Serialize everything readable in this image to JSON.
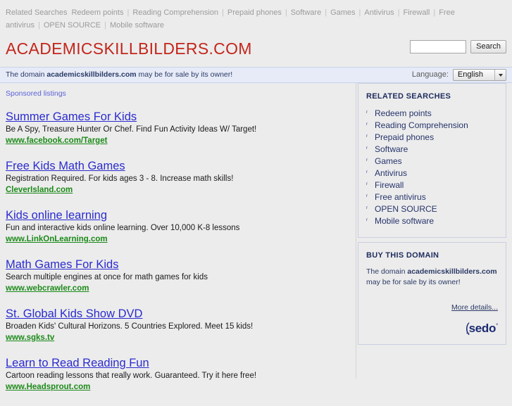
{
  "topnav": {
    "label": "Related Searches",
    "separator": "|",
    "items": [
      "Redeem points",
      "Reading Comprehension",
      "Prepaid phones",
      "Software",
      "Games",
      "Antivirus",
      "Firewall",
      "Free antivirus",
      "OPEN SOURCE",
      "Mobile software"
    ]
  },
  "header": {
    "logo": "ACADEMICSKILLBILDERS.COM",
    "logo_color": "#c3261b",
    "search_value": "",
    "search_placeholder": "",
    "search_button": "Search"
  },
  "notice": {
    "prefix": "The domain ",
    "domain": "academicskillbilders.com",
    "suffix": " may be for sale by its owner!",
    "language_label": "Language:",
    "language_value": "English"
  },
  "listings": {
    "sponsored_label": "Sponsored listings",
    "items": [
      {
        "title": "Summer Games For Kids",
        "desc": "Be A Spy, Treasure Hunter Or Chef. Find Fun Activity Ideas W/ Target!",
        "url": "www.facebook.com/Target"
      },
      {
        "title": "Free Kids Math Games",
        "desc": "Registration Required. For kids ages 3 - 8. Increase math skills!",
        "url": "CleverIsland.com"
      },
      {
        "title": "Kids online learning",
        "desc": "Fun and interactive kids online learning. Over 10,000 K-8 lessons",
        "url": "www.LinkOnLearning.com"
      },
      {
        "title": "Math Games For Kids",
        "desc": "Search multiple engines at once for math games for kids",
        "url": "www.webcrawler.com"
      },
      {
        "title": "St. Global Kids Show DVD",
        "desc": "Broaden Kids' Cultural Horizons. 5 Countries Explored. Meet 15 kids!",
        "url": "www.sgks.tv"
      },
      {
        "title": "Learn to Read Reading Fun",
        "desc": "Cartoon reading lessons that really work. Guaranteed. Try it here free!",
        "url": "www.Headsprout.com"
      }
    ]
  },
  "sidebar": {
    "related": {
      "title": "RELATED SEARCHES",
      "bullet": "ʳ",
      "items": [
        "Redeem points",
        "Reading Comprehension",
        "Prepaid phones",
        "Software",
        "Games",
        "Antivirus",
        "Firewall",
        "Free antivirus",
        "OPEN SOURCE",
        "Mobile software"
      ]
    },
    "buy": {
      "title": "BUY THIS DOMAIN",
      "prefix": "The domain ",
      "domain": "academicskillbilders.com",
      "suffix": " may be for sale by its owner!",
      "more_details": "More details...",
      "logo_paren": "(",
      "logo_text": "sedo",
      "logo_tm": "°",
      "logo_dots": ".."
    }
  }
}
